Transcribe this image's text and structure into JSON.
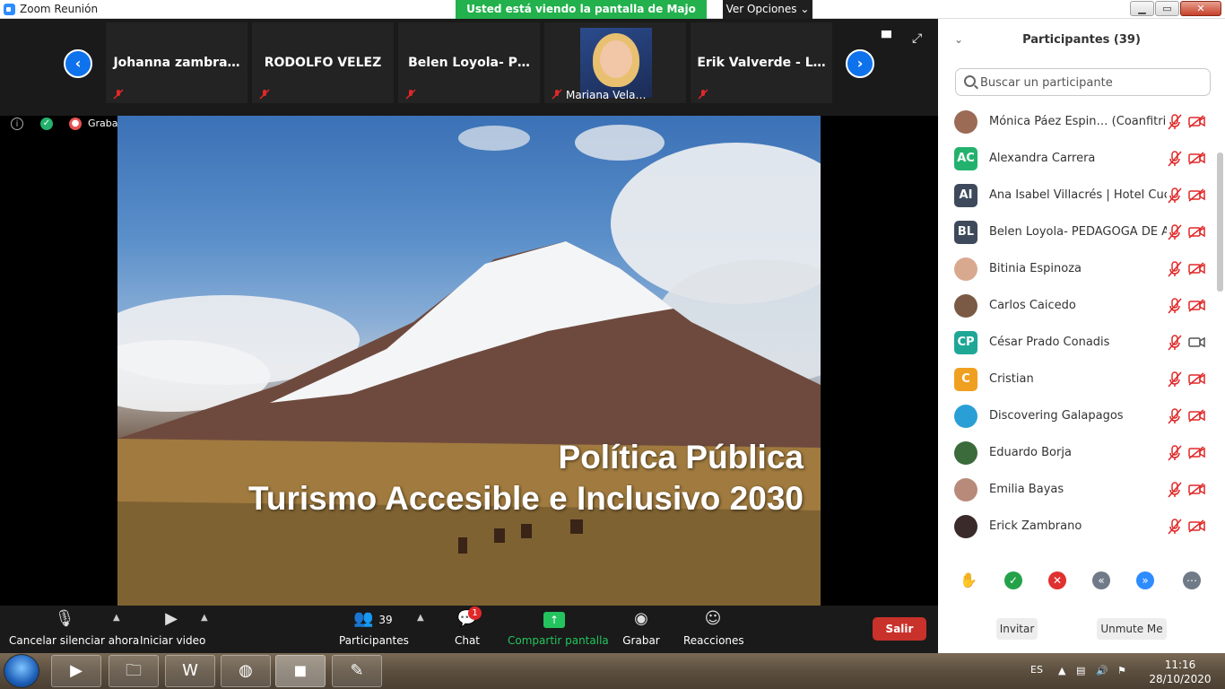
{
  "window": {
    "title": "Zoom Reunión",
    "share_banner": "Usted está viendo la pantalla de Majo Navas",
    "view_options": "Ver Opciones"
  },
  "strip": {
    "tiles": [
      {
        "name": "Johanna  zambra…"
      },
      {
        "name": "RODOLFO VELEZ"
      },
      {
        "name": "Belen Loyola- P…"
      },
      {
        "name": "Mariana Vela…"
      },
      {
        "name": "Erik Valverde - L…"
      }
    ]
  },
  "status": {
    "recording": "Grabación"
  },
  "slide": {
    "title_line1": "Política Pública",
    "title_line2": "Turismo Accesible e Inclusivo 2030"
  },
  "toolbar": {
    "mute": "Cancelar silenciar ahora",
    "video": "Iniciar video",
    "participants": "Participantes",
    "participants_count": "39",
    "chat": "Chat",
    "chat_badge": "1",
    "share": "Compartir pantalla",
    "record": "Grabar",
    "reactions": "Reacciones",
    "leave": "Salir"
  },
  "panel": {
    "title": "Participantes (39)",
    "search_placeholder": "Buscar un participante",
    "participants": [
      {
        "name": "Mónica Páez Espin… (Coanfitrión)",
        "initials": "",
        "color": "#9b6b55",
        "video": "off"
      },
      {
        "name": "Alexandra Carrera",
        "initials": "AC",
        "color": "#23b26d",
        "video": "off"
      },
      {
        "name": "Ana Isabel Villacrés | Hotel Cucu…",
        "initials": "AI",
        "color": "#3e4a5c",
        "video": "off"
      },
      {
        "name": "Belen Loyola- PEDAGOGA DE A…",
        "initials": "BL",
        "color": "#3e4a5c",
        "video": "off"
      },
      {
        "name": "Bitinia Espinoza",
        "initials": "",
        "color": "#d9a98f",
        "video": "off"
      },
      {
        "name": "Carlos Caicedo",
        "initials": "",
        "color": "#7a5a45",
        "video": "off"
      },
      {
        "name": "César Prado Conadis",
        "initials": "CP",
        "color": "#1fa796",
        "video": "on"
      },
      {
        "name": "Cristian",
        "initials": "C",
        "color": "#f0a020",
        "video": "off"
      },
      {
        "name": "Discovering Galapagos",
        "initials": "",
        "color": "#2a9fd6",
        "video": "off"
      },
      {
        "name": "Eduardo Borja",
        "initials": "",
        "color": "#3b6b3a",
        "video": "off"
      },
      {
        "name": "Emilia Bayas",
        "initials": "",
        "color": "#b88a7a",
        "video": "off"
      },
      {
        "name": "Erick Zambrano",
        "initials": "",
        "color": "#3a2a2a",
        "video": "off"
      }
    ],
    "invite": "Invitar",
    "unmute_me": "Unmute Me"
  },
  "taskbar": {
    "lang": "ES",
    "time": "11:16",
    "date": "28/10/2020"
  }
}
